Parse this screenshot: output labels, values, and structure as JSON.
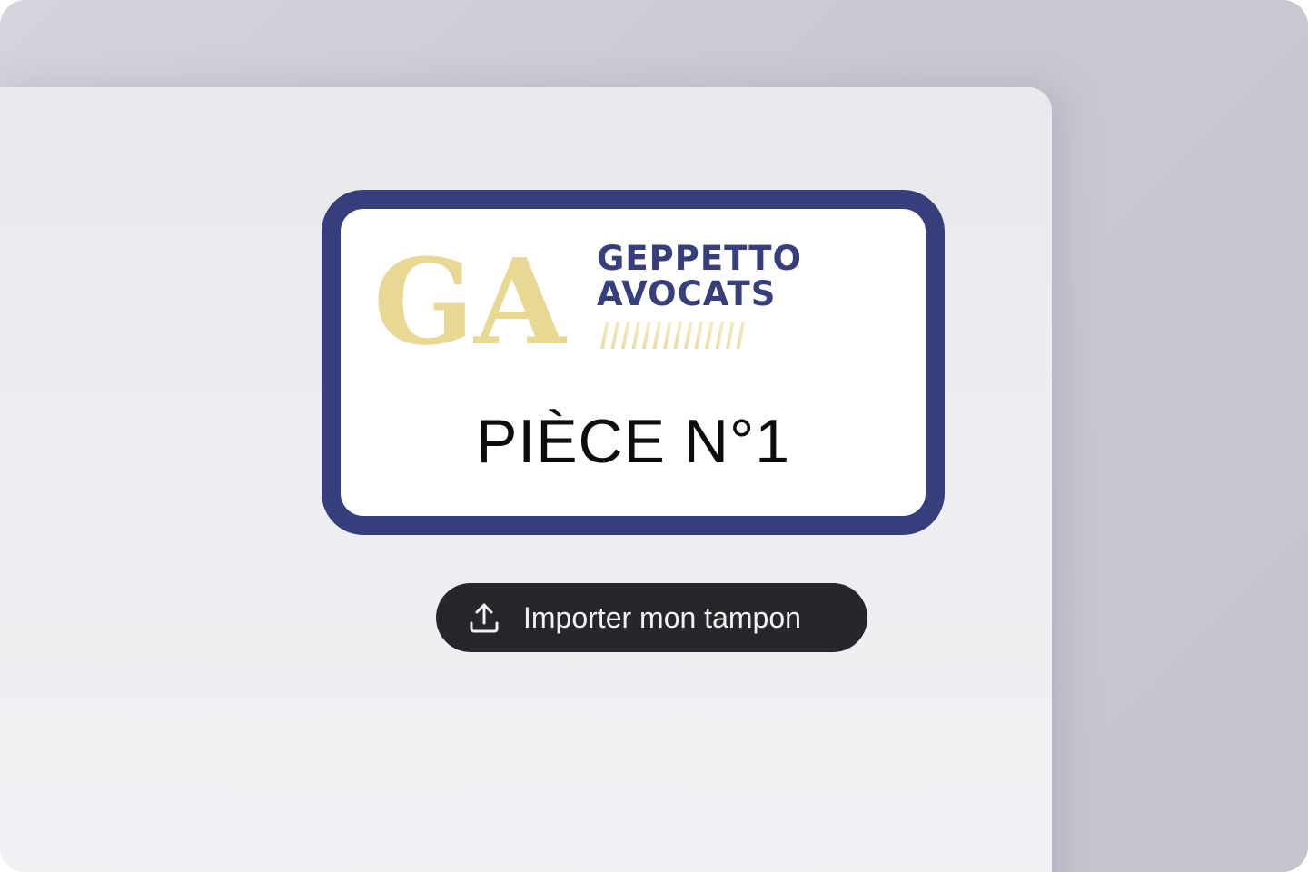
{
  "stamp": {
    "logo": {
      "monogram": "GA",
      "brand_line_1": "GEPPETTO",
      "brand_line_2": "AVOCATS"
    },
    "label": "PIÈCE N°1"
  },
  "import_button": {
    "label": "Importer mon tampon",
    "icon": "upload-icon"
  },
  "colors": {
    "stamp_border": "#363f7c",
    "brand_text": "#363f7c",
    "logo_gold": "#e8d894",
    "button_bg": "#26272b",
    "button_text": "#f2f2f2"
  }
}
